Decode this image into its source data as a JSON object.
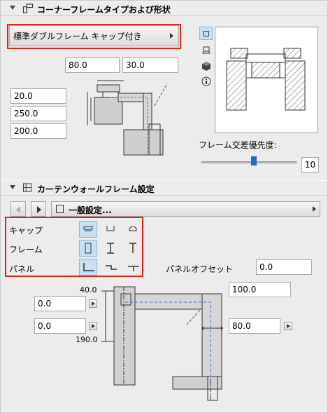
{
  "section1": {
    "title": "コーナーフレームタイプおよび形状"
  },
  "frame_type": {
    "value": "標準ダブルフレーム キャップ付き"
  },
  "dims_top": {
    "width": "80.0",
    "depth": "30.0"
  },
  "dims_left": {
    "a": "20.0",
    "b": "250.0",
    "c": "200.0"
  },
  "view_modes": [
    "floor-plan-view",
    "section-view",
    "3d-view",
    "info"
  ],
  "frame_intersection": {
    "label": "フレーム交差優先度:",
    "value": "10",
    "slider_fraction": 0.55
  },
  "section2": {
    "title": "カーテンウォールフレーム設定"
  },
  "nav": {
    "settings_label": "一般設定..."
  },
  "rows": {
    "cap": {
      "label": "キャップ"
    },
    "frame": {
      "label": "フレーム"
    },
    "panel": {
      "label": "パネル"
    }
  },
  "panel_offset": {
    "label": "パネルオフセット",
    "value": "0.0"
  },
  "bottom_dims": {
    "left1": "0.0",
    "left2": "0.0",
    "right1": "100.0",
    "right2": "80.0",
    "top_label": "40.0",
    "bottom_label": "190.0"
  }
}
